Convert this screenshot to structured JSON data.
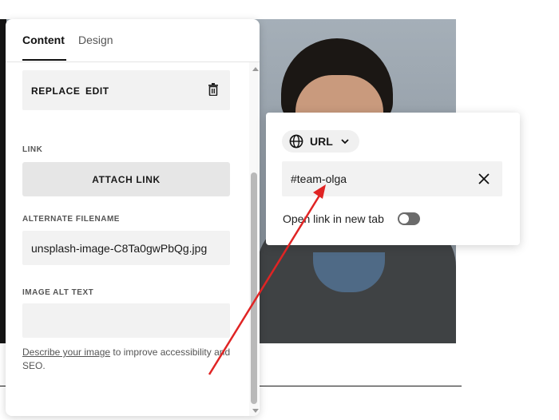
{
  "tabs": [
    {
      "label": "Content"
    },
    {
      "label": "Design"
    }
  ],
  "image_actions": {
    "replace_label": "REPLACE",
    "edit_label": "EDIT"
  },
  "link": {
    "section_label": "LINK",
    "attach_label": "ATTACH LINK"
  },
  "filename": {
    "section_label": "ALTERNATE FILENAME",
    "value": "unsplash-image-C8Ta0gwPbQg.jpg"
  },
  "alt_text": {
    "section_label": "IMAGE ALT TEXT",
    "value": "",
    "helper_link": "Describe your image",
    "helper_rest": " to improve accessibility and SEO."
  },
  "popover": {
    "type_label": "URL",
    "url_value": "#team-olga",
    "newtab_label": "Open link in new tab",
    "newtab_enabled": false
  },
  "icons": {
    "trash": "trash-icon",
    "globe": "globe-icon",
    "chevron": "chevron-down-icon",
    "clear": "close-icon"
  },
  "colors": {
    "annotation_arrow": "#e02424",
    "toggle_off": "#6b6b6b"
  }
}
